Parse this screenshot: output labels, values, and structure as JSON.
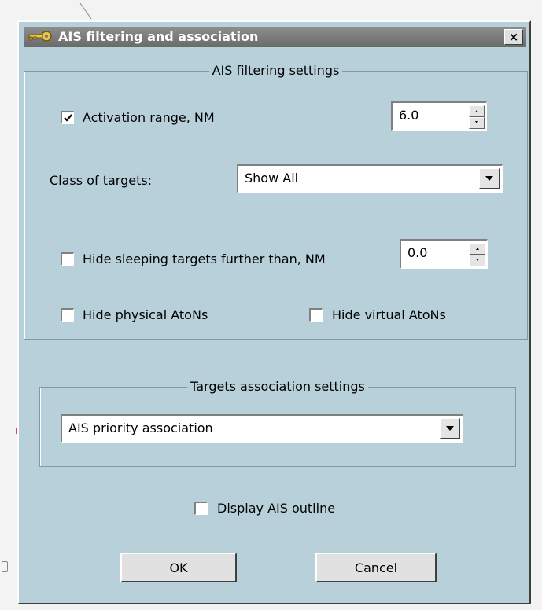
{
  "window": {
    "title": "AIS filtering and association",
    "close_label": "×"
  },
  "filtering": {
    "legend": "AIS filtering settings",
    "activation_range": {
      "label": "Activation  range, NM",
      "checked": true,
      "value": "6.0"
    },
    "class_of_targets": {
      "label": "Class of targets:",
      "value": "Show All"
    },
    "hide_sleeping": {
      "label": "Hide sleeping targets further than, NM",
      "checked": false,
      "value": "0.0"
    },
    "hide_physical": {
      "label": "Hide physical AtoNs",
      "checked": false
    },
    "hide_virtual": {
      "label": "Hide virtual AtoNs",
      "checked": false
    }
  },
  "association": {
    "legend": "Targets association settings",
    "value": "AIS priority association"
  },
  "display_outline": {
    "label": "Display AIS outline",
    "checked": false
  },
  "buttons": {
    "ok": "OK",
    "cancel": "Cancel"
  },
  "colors": {
    "dialog_bg": "#b8d0da",
    "titlebar": "#7a7a7a"
  },
  "icons": {
    "title": "key-icon"
  }
}
